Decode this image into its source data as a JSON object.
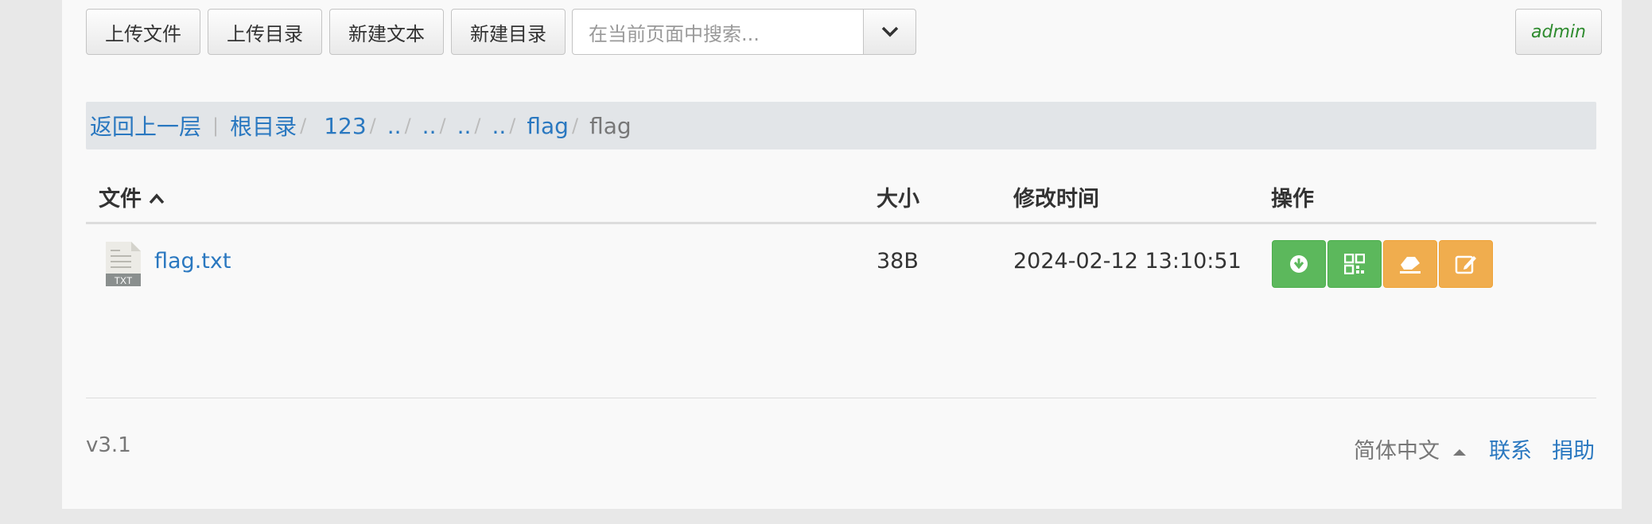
{
  "toolbar": {
    "upload_file": "上传文件",
    "upload_dir": "上传目录",
    "new_text": "新建文本",
    "new_dir": "新建目录",
    "search_placeholder": "在当前页面中搜索...",
    "user": "admin"
  },
  "breadcrumb": {
    "back": "返回上一层",
    "root": "根目录",
    "items": [
      "123",
      "..",
      "..",
      "..",
      "..",
      "flag"
    ],
    "current": "flag"
  },
  "table": {
    "headers": {
      "name": "文件",
      "size": "大小",
      "mtime": "修改时间",
      "actions": "操作"
    },
    "rows": [
      {
        "icon_label": "TXT",
        "name": "flag.txt",
        "size": "38B",
        "mtime": "2024-02-12 13:10:51"
      }
    ]
  },
  "footer": {
    "version": "v3.1",
    "language": "简体中文",
    "contact": "联系",
    "donate": "捐助"
  },
  "colors": {
    "link": "#2a78c0",
    "green": "#5cb85c",
    "orange": "#f0ad4e"
  }
}
